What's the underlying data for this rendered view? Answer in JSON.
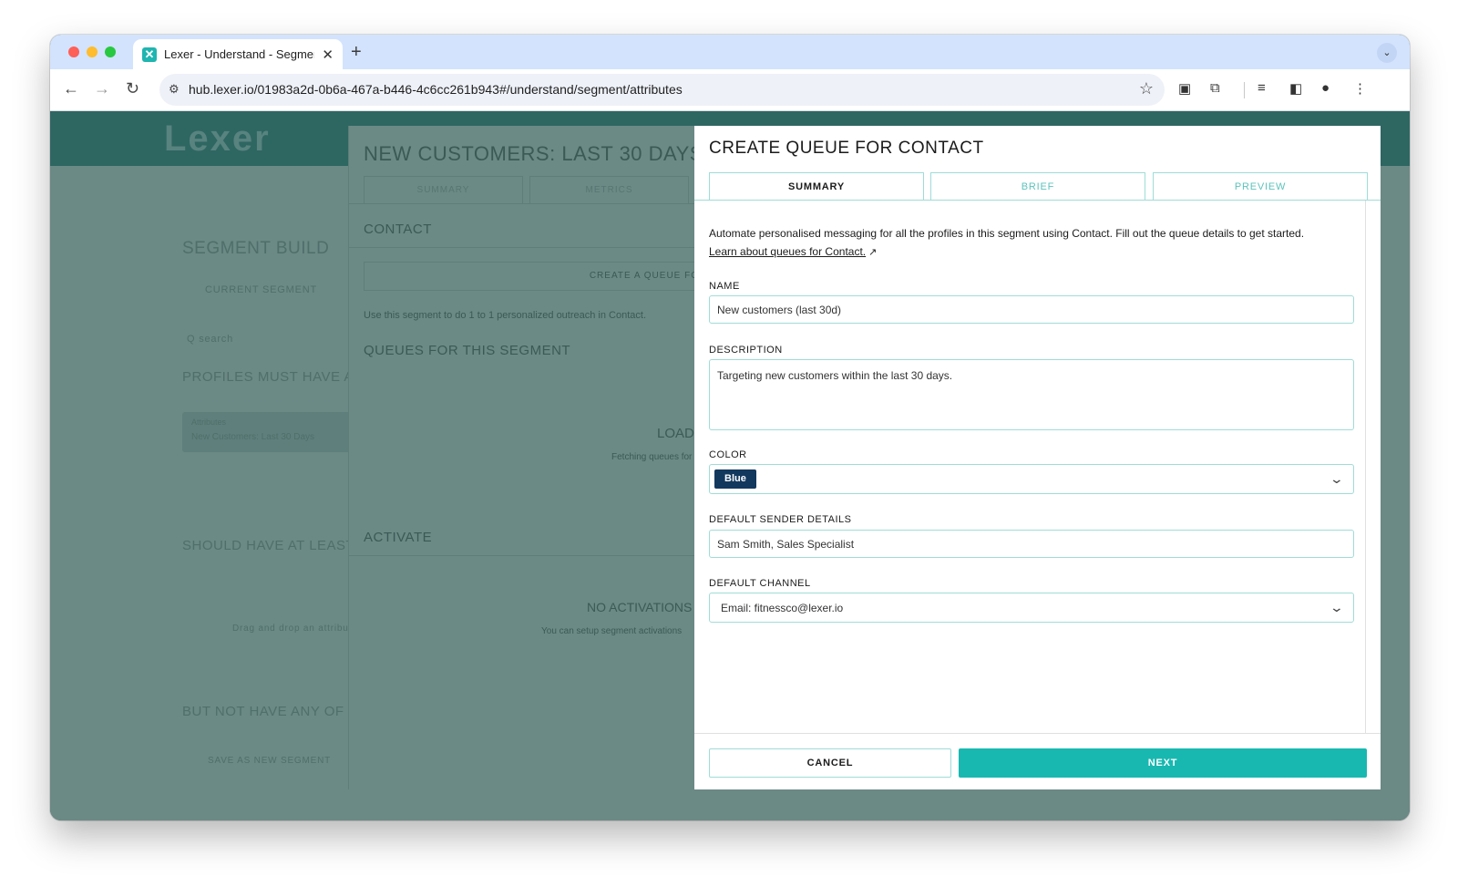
{
  "browser": {
    "tab_title": "Lexer - Understand - Segment",
    "tab_favicon": "lexer-x-icon",
    "url": "hub.lexer.io/01983a2d-0b6a-467a-b446-4c6cc261b943#/understand/segment/attributes"
  },
  "background": {
    "logo": "Lexer",
    "heading_segment_builder": "SEGMENT BUILD",
    "tab_current_segment": "CURRENT SEGMENT",
    "search_placeholder": "Q search",
    "heading_profiles_must": "PROFILES MUST HAVE AL",
    "chip_line1": "Attributes",
    "chip_line2": "New Customers: Last 30 Days",
    "heading_should_have": "SHOULD HAVE AT LEAST",
    "drag_hint": "Drag and drop an attribute",
    "heading_but_not": "BUT NOT HAVE ANY OF TH",
    "save_new_segment": "SAVE AS NEW SEGMENT"
  },
  "middle": {
    "title": "NEW CUSTOMERS: LAST 30 DAYS",
    "tab_summary": "SUMMARY",
    "tab_metrics": "METRICS",
    "contact_heading": "CONTACT",
    "create_queue_button": "CREATE A QUEUE FO",
    "contact_desc": "Use this segment to do 1 to 1 personalized outreach in Contact.",
    "queues_heading": "QUEUES FOR THIS SEGMENT",
    "loading": "LOADI",
    "fetching": "Fetching queues for",
    "activate_heading": "ACTIVATE",
    "no_activations": "NO ACTIVATIONS",
    "activations_desc": "You can setup segment activations"
  },
  "drawer": {
    "title": "CREATE QUEUE FOR CONTACT",
    "tabs": [
      "SUMMARY",
      "BRIEF",
      "PREVIEW"
    ],
    "intro": "Automate personalised messaging for all the profiles in this segment using Contact. Fill out the queue details to get started.",
    "learn_link": "Learn about queues for Contact.",
    "name_label": "NAME",
    "name_value": "New customers (last 30d)",
    "description_label": "DESCRIPTION",
    "description_value": "Targeting new customers within the last 30 days.",
    "color_label": "COLOR",
    "color_value": "Blue",
    "color_hex": "#12385e",
    "sender_label": "DEFAULT SENDER DETAILS",
    "sender_value": "Sam Smith, Sales Specialist",
    "channel_label": "DEFAULT CHANNEL",
    "channel_value": "Email: fitnessco@lexer.io",
    "cancel_label": "CANCEL",
    "next_label": "NEXT",
    "accent_color": "#18b8b0"
  }
}
